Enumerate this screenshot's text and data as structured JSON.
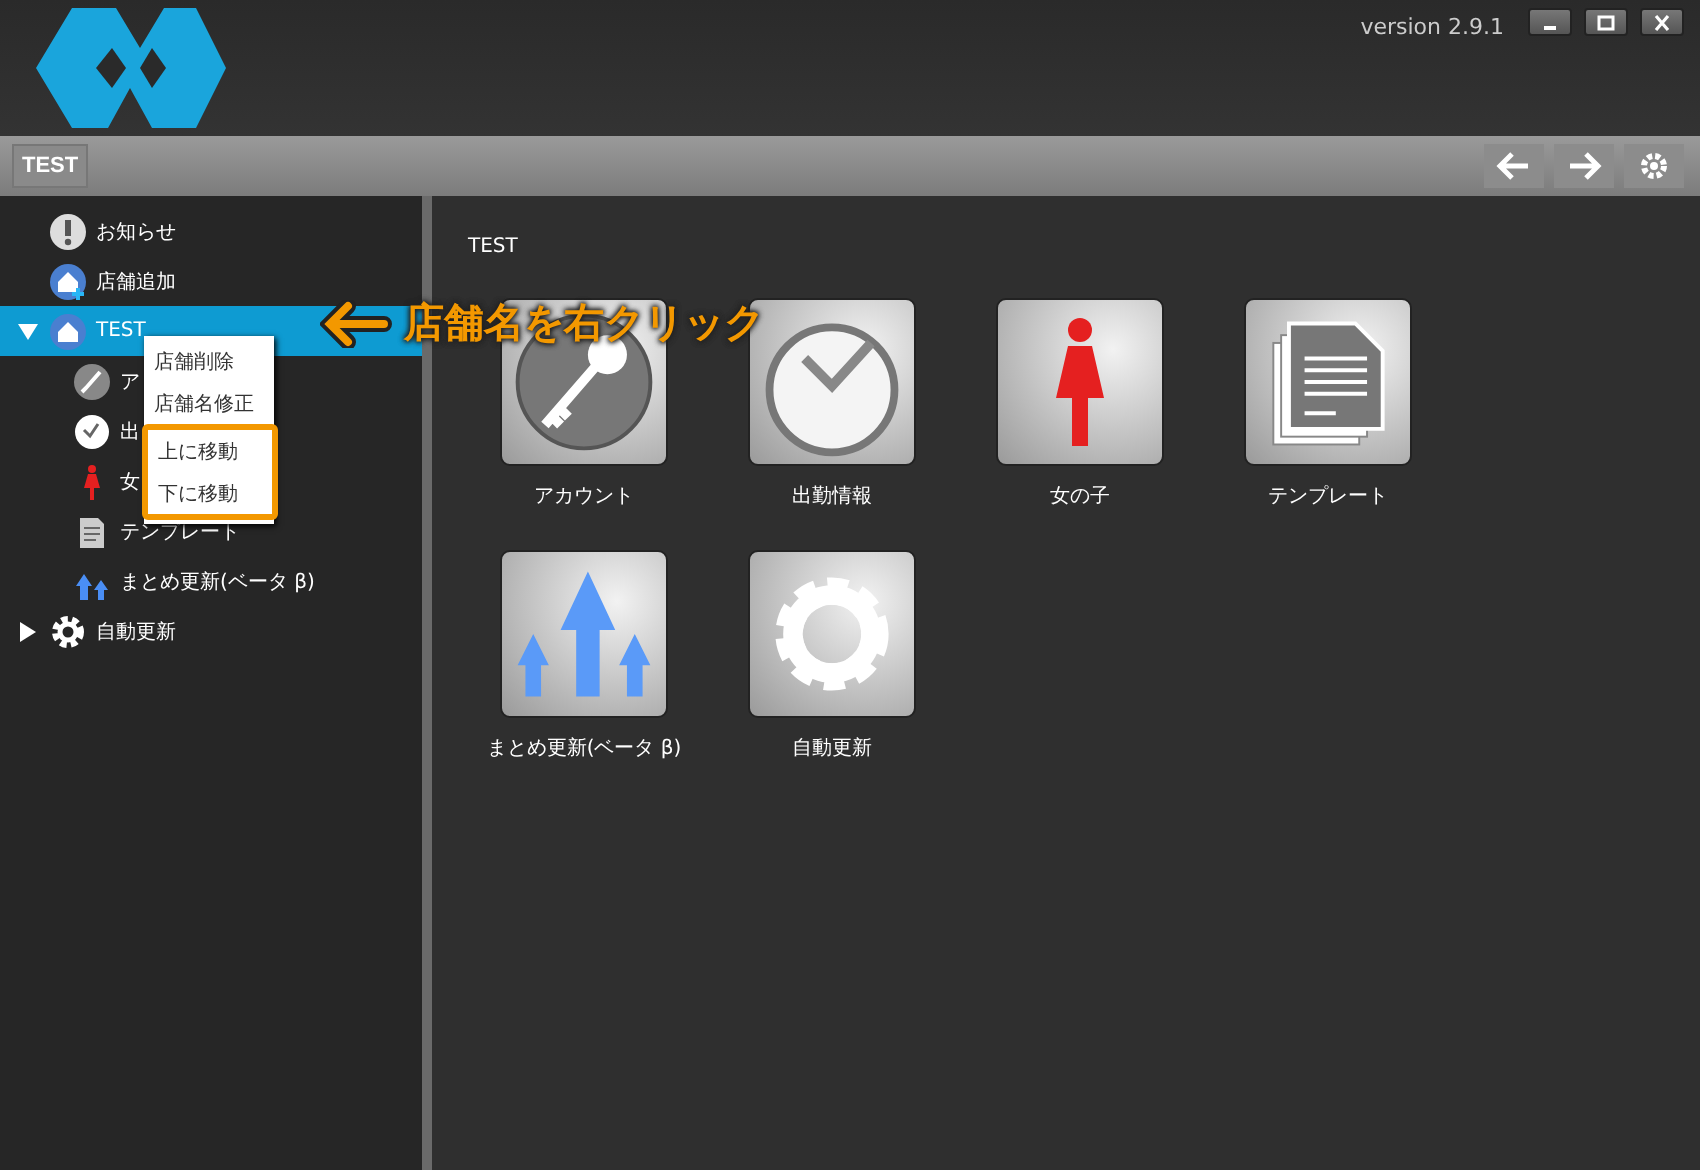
{
  "window": {
    "version": "version 2.9.1"
  },
  "toolbar": {
    "breadcrumb": "TEST"
  },
  "sidebar": {
    "items": [
      {
        "label": "お知らせ",
        "selected": false
      },
      {
        "label": "店舗追加",
        "selected": false
      },
      {
        "label": "TEST",
        "expanded": true,
        "selected": true,
        "children": [
          {
            "label": "ア",
            "selected": false
          },
          {
            "label": "出",
            "selected": false
          },
          {
            "label": "女",
            "selected": false
          },
          {
            "label": "テンプレート",
            "selected": false
          },
          {
            "label": "まとめ更新(ベータ β)",
            "selected": false
          }
        ]
      },
      {
        "label": "自動更新",
        "expanded": false,
        "selected": false
      }
    ]
  },
  "context_menu": {
    "items": [
      {
        "label": "店舗削除",
        "highlighted": false
      },
      {
        "label": "店舗名修正",
        "highlighted": false
      },
      {
        "label": "上に移動",
        "highlighted": true
      },
      {
        "label": "下に移動",
        "highlighted": true
      }
    ]
  },
  "annotation": {
    "text": "店舗名を右クリック"
  },
  "main": {
    "heading": "TEST",
    "tiles": [
      {
        "label": "アカウント"
      },
      {
        "label": "出勤情報"
      },
      {
        "label": "女の子"
      },
      {
        "label": "テンプレート"
      },
      {
        "label": "まとめ更新(ベータ β)"
      },
      {
        "label": "自動更新"
      }
    ]
  }
}
